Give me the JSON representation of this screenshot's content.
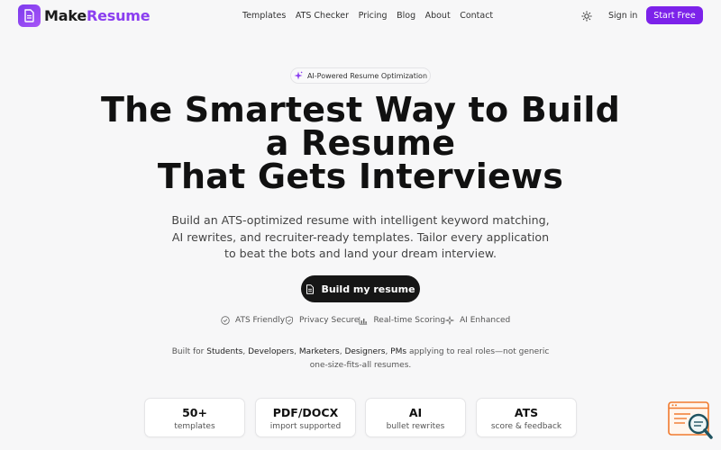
{
  "brand": {
    "name_part1": "Make",
    "name_part2": "Resume",
    "accent": "#8b3ff0"
  },
  "nav": {
    "links": [
      "Templates",
      "ATS Checker",
      "Pricing",
      "Blog",
      "About",
      "Contact"
    ],
    "theme_icon": "sun-icon",
    "sign_in": "Sign in",
    "start_free": "Start Free"
  },
  "hero": {
    "badge": "AI-Powered Resume Optimization",
    "title_line1": "The Smartest Way to Build",
    "title_line2": "a Resume",
    "title_line3": "That Gets Interviews",
    "description": "Build an ATS-optimized resume with intelligent keyword matching, AI rewrites, and recruiter-ready templates. Tailor every application to beat the bots and land your dream interview.",
    "cta": "Build my resume"
  },
  "features": [
    {
      "icon": "check-circle-icon",
      "label": "ATS Friendly"
    },
    {
      "icon": "shield-check-icon",
      "label": "Privacy Secure"
    },
    {
      "icon": "bar-chart-icon",
      "label": "Real-time Scoring"
    },
    {
      "icon": "sparkle-icon",
      "label": "AI Enhanced"
    }
  ],
  "audience": {
    "prefix": "Built for",
    "roles": [
      "Students",
      "Developers",
      "Marketers",
      "Designers",
      "PMs"
    ],
    "suffix": "applying to real roles—not generic one-size-fits-all resumes."
  },
  "stats": [
    {
      "value": "50+",
      "label": "templates"
    },
    {
      "value": "PDF/DOCX",
      "label": "import supported"
    },
    {
      "value": "AI",
      "label": "bullet rewrites"
    },
    {
      "value": "ATS",
      "label": "score & feedback"
    }
  ]
}
